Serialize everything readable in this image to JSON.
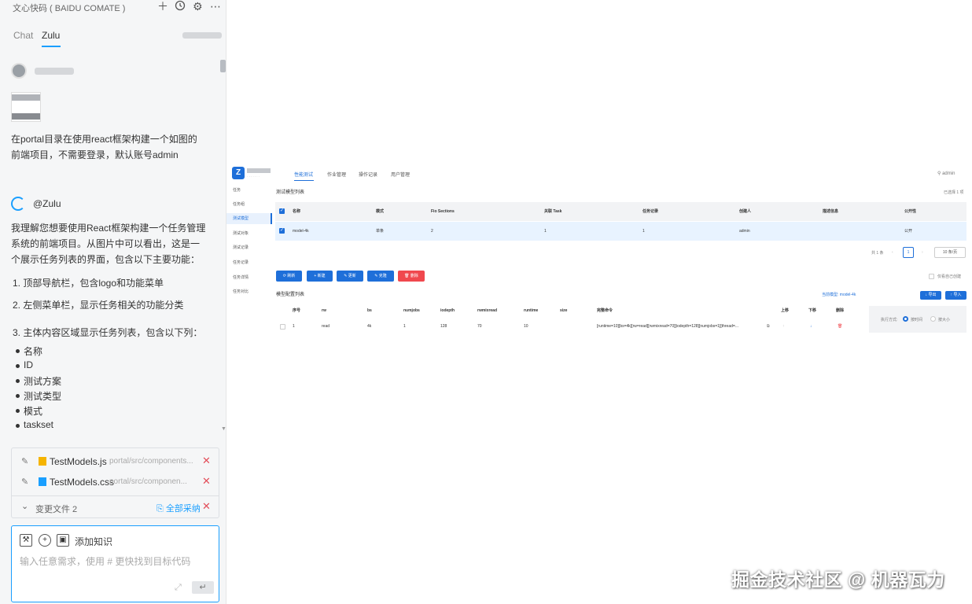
{
  "chat": {
    "app_title": "文心快码 ( BAIDU COMATE )",
    "header_icons": [
      "plus-icon",
      "history-icon",
      "gear-icon",
      "more-icon"
    ],
    "tabs": [
      {
        "label": "Chat",
        "active": false
      },
      {
        "label": "Zulu",
        "active": true
      }
    ],
    "user_message": [
      "在portal目录在使用react框架构建一个如图的",
      "前端项目，不需要登录，默认账号admin"
    ],
    "assistant_name": "@Zulu",
    "assistant_intro": [
      "我理解您想要使用React框架构建一个任务管理",
      "系统的前端项目。从图片中可以看出，这是一",
      "个展示任务列表的界面，包含以下主要功能："
    ],
    "features": [
      "1. 顶部导航栏，包含logo和功能菜单",
      "2. 左侧菜单栏，显示任务相关的功能分类",
      "3. 主体内容区域显示任务列表，包含以下列："
    ],
    "columns": [
      "名称",
      "ID",
      "测试方案",
      "测试类型",
      "模式",
      "taskset"
    ],
    "files": [
      {
        "name": "TestModels.js",
        "path": "portal/src/components...",
        "icon_color": "#f5b400"
      },
      {
        "name": "TestModels.css",
        "path": "portal/src/componen...",
        "icon_color": "#1a9fff"
      }
    ],
    "files_footer": {
      "label": "变更文件 2",
      "accept": "全部采纳"
    },
    "input": {
      "knowledge": "添加知识",
      "placeholder": "输入任意需求，使用 # 更快找到目标代码"
    }
  },
  "preview": {
    "nav": [
      "性能测试",
      "作业管理",
      "操作记录",
      "用户管理"
    ],
    "user": "admin",
    "sidebar": [
      "任务",
      "任务组",
      "测试模型",
      "测试对象",
      "测试记录",
      "任务记录",
      "任务详情",
      "任务对比"
    ],
    "sidebar_active": 2,
    "model_list": {
      "title": "测试模型列表",
      "selected_info": "已选择 1 项",
      "headers": [
        "名称",
        "模式",
        "Fio Sections",
        "关联 Task",
        "任务记录",
        "创建人",
        "描述信息",
        "公开性"
      ],
      "row": [
        "model-4k",
        "单条",
        "2",
        "1",
        "1",
        "admin",
        "",
        "公开"
      ],
      "pagination": {
        "total": "共 1 条",
        "page": "1",
        "page_size": "10 条/页"
      }
    },
    "buttons": [
      {
        "label": "刷新",
        "color": "#1e6fd9"
      },
      {
        "label": "新建",
        "color": "#1e6fd9"
      },
      {
        "label": "更新",
        "color": "#1e6fd9"
      },
      {
        "label": "克隆",
        "color": "#1e6fd9"
      },
      {
        "label": "删除",
        "color": "#f0484e"
      }
    ],
    "only_mine": "仅看自己创建",
    "config_list": {
      "title": "模型配置列表",
      "current_model": "当前模型: model-4k",
      "export": "导出",
      "import": "导入",
      "headers": [
        "序号",
        "rw",
        "bs",
        "numjobs",
        "iodepth",
        "rwmixread",
        "runtime",
        "size",
        "完整命令",
        "上移",
        "下移",
        "删除"
      ],
      "row": [
        "1",
        "read",
        "4k",
        "1",
        "128",
        "70",
        "10",
        "",
        "[runtime=10][bs=4k][rw=read][rwmixread=70][iodepth=128][numjobs=1][thread=..."
      ],
      "exec_label": "执行方式:",
      "exec_options": [
        "按时间",
        "按大小"
      ]
    }
  },
  "watermark": "掘金技术社区 @ 机器瓦力",
  "colors": {
    "accent": "#1a9fff",
    "preview_blue": "#1e6fd9",
    "danger": "#e34d59"
  }
}
